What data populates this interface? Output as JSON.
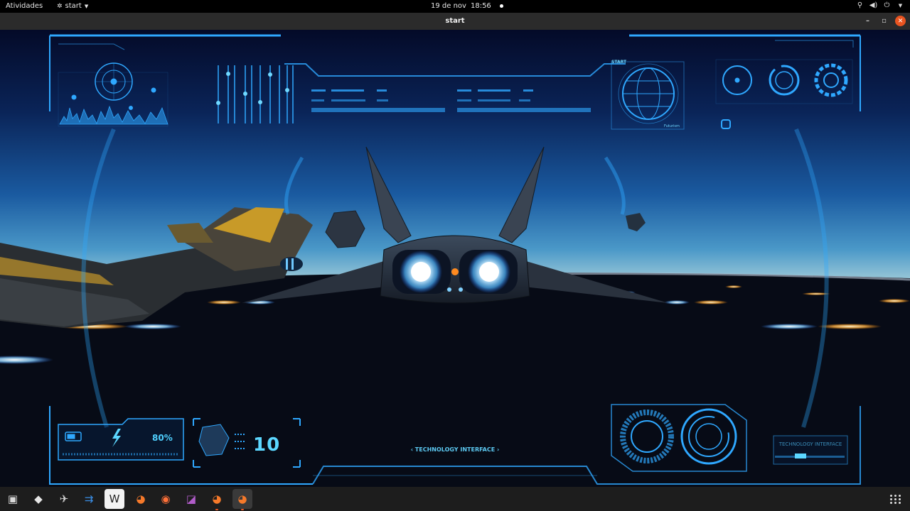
{
  "topbar": {
    "activities": "Atividades",
    "app_name": "start",
    "date": "19 de nov",
    "time": "18:56",
    "tray_icons": [
      "network-icon",
      "volume-icon",
      "power-icon",
      "chevron-down-icon"
    ]
  },
  "window": {
    "title": "start",
    "controls": [
      "minimize",
      "maximize",
      "close"
    ]
  },
  "hud": {
    "battery_label": "80%",
    "battery_level": 0.8,
    "counter": "10",
    "tech_center": "‹ TECHNOLOGY INTERFACE ›",
    "tech_right": "TECHNOLOGY INTERFACE",
    "globe_label": "START",
    "globe_footer": "Futurism",
    "colors": {
      "hud_primary": "#2fa8ff",
      "hud_glow": "#5cd7ff",
      "engine_glow": "#dff4ff",
      "lights_orange": "#ffb347"
    }
  },
  "dock": {
    "apps": [
      {
        "name": "files",
        "icon": "files-icon",
        "glyph": "▣",
        "color": "#d9d9d9"
      },
      {
        "name": "inkscape",
        "icon": "inkscape-icon",
        "glyph": "◆",
        "color": "#e6e6e6"
      },
      {
        "name": "godot-spaceship",
        "icon": "spaceship-icon",
        "glyph": "✈",
        "color": "#d0d0d0"
      },
      {
        "name": "code-editor",
        "icon": "editor-icon",
        "glyph": "⇉",
        "color": "#3a8ee6"
      },
      {
        "name": "wondershare",
        "icon": "wps-icon",
        "glyph": "W",
        "color": "#222"
      },
      {
        "name": "blender-1",
        "icon": "blender-icon",
        "glyph": "◕",
        "color": "#f5792a"
      },
      {
        "name": "firefox",
        "icon": "firefox-icon",
        "glyph": "◉",
        "color": "#ff7139"
      },
      {
        "name": "mono-app",
        "icon": "purple-app-icon",
        "glyph": "◪",
        "color": "#b05cc8"
      },
      {
        "name": "blender-2",
        "icon": "blender-icon",
        "glyph": "◕",
        "color": "#f5792a"
      },
      {
        "name": "blender-3",
        "icon": "blender-icon",
        "glyph": "◕",
        "color": "#f5792a"
      }
    ],
    "show_apps": "grid-icon"
  }
}
